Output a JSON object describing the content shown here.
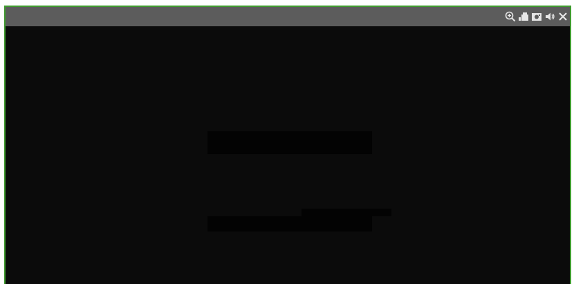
{
  "toolbar": {
    "buttons": [
      {
        "icon": "zoom-in-icon"
      },
      {
        "icon": "record-icon"
      },
      {
        "icon": "snapshot-icon"
      },
      {
        "icon": "audio-icon"
      },
      {
        "icon": "close-icon"
      }
    ]
  },
  "colors": {
    "border": "#3f9a2f",
    "titlebar": "#5c5c5c",
    "video_background": "#0b0b0b",
    "icon": "#e6e6e6"
  }
}
